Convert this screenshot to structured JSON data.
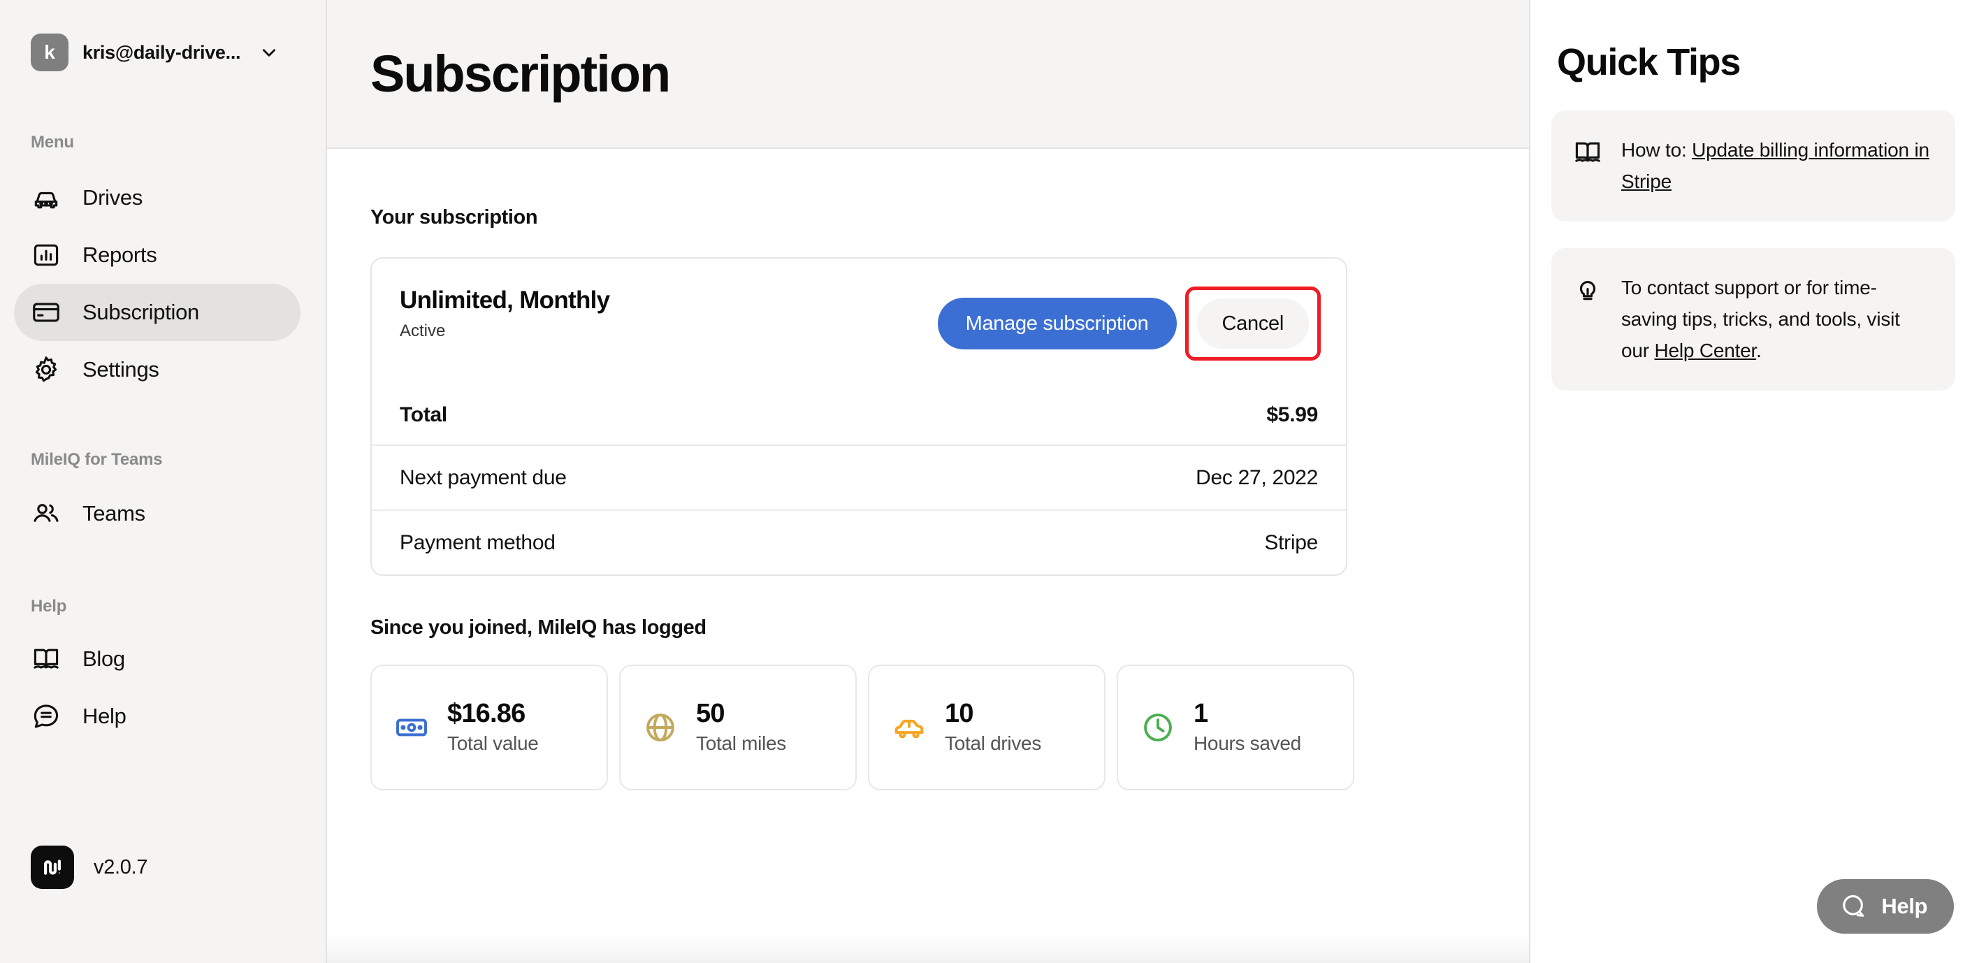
{
  "sidebar": {
    "account": {
      "avatar_initial": "k",
      "email": "kris@daily-drive...",
      "chevron_icon": "chevron-down-icon"
    },
    "menu_label": "Menu",
    "menu_items": [
      {
        "label": "Drives",
        "icon": "car-icon",
        "active": false
      },
      {
        "label": "Reports",
        "icon": "bar-chart-icon",
        "active": false
      },
      {
        "label": "Subscription",
        "icon": "credit-card-icon",
        "active": true
      },
      {
        "label": "Settings",
        "icon": "gear-icon",
        "active": false
      }
    ],
    "teams_label": "MileIQ for Teams",
    "teams_items": [
      {
        "label": "Teams",
        "icon": "people-icon",
        "active": false
      }
    ],
    "help_label": "Help",
    "help_items": [
      {
        "label": "Blog",
        "icon": "book-icon",
        "active": false
      },
      {
        "label": "Help",
        "icon": "chat-bubble-icon",
        "active": false
      }
    ],
    "version": "v2.0.7",
    "logo_icon": "mileiq-logo-icon"
  },
  "main": {
    "page_title": "Subscription",
    "your_subscription_label": "Your subscription",
    "plan": {
      "name": "Unlimited, Monthly",
      "status": "Active",
      "manage_label": "Manage subscription",
      "cancel_label": "Cancel"
    },
    "rows": [
      {
        "key": "Total",
        "value": "$5.99",
        "bold": true
      },
      {
        "key": "Next payment due",
        "value": "Dec 27, 2022",
        "bold": false
      },
      {
        "key": "Payment method",
        "value": "Stripe",
        "bold": false
      }
    ],
    "stats_heading": "Since you joined, MileIQ has logged",
    "stats": [
      {
        "value": "$16.86",
        "label": "Total value",
        "icon": "banknote-icon",
        "color": "#3b6fd4"
      },
      {
        "value": "50",
        "label": "Total miles",
        "icon": "globe-icon",
        "color": "#c4a95c"
      },
      {
        "value": "10",
        "label": "Total drives",
        "icon": "car-side-icon",
        "color": "#f5a623"
      },
      {
        "value": "1",
        "label": "Hours saved",
        "icon": "clock-icon",
        "color": "#4caf50"
      }
    ]
  },
  "tips": {
    "title": "Quick Tips",
    "items": [
      {
        "icon": "book-icon",
        "prefix": "How to: ",
        "link": "Update billing information in Stripe",
        "suffix": ""
      },
      {
        "icon": "lightbulb-icon",
        "prefix": "To contact support or for time-saving tips, tricks, and tools, visit our ",
        "link": "Help Center",
        "suffix": "."
      }
    ]
  },
  "help_fab": {
    "label": "Help",
    "icon": "chat-bubble-icon",
    "color": "#808080"
  },
  "colors": {
    "accent_blue": "#3b6fd4",
    "highlight_red": "#ee1c25",
    "sidebar_bg": "#f5f4f2",
    "active_item_bg": "#e3e2e0"
  }
}
